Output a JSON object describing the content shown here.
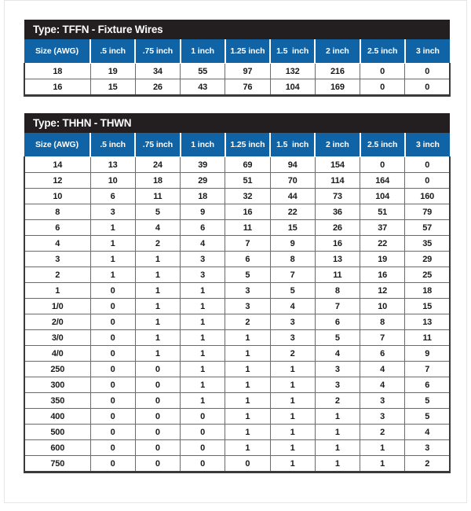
{
  "tables": [
    {
      "title": "Type: TFFN - Fixture Wires",
      "columns": [
        "Size (AWG)",
        ".5 inch",
        ".75 inch",
        "1 inch",
        "1.25 inch",
        "1.5  inch",
        "2 inch",
        "2.5 inch",
        "3 inch"
      ],
      "rows": [
        [
          "18",
          "19",
          "34",
          "55",
          "97",
          "132",
          "216",
          "0",
          "0"
        ],
        [
          "16",
          "15",
          "26",
          "43",
          "76",
          "104",
          "169",
          "0",
          "0"
        ]
      ]
    },
    {
      "title": "Type: THHN - THWN",
      "columns": [
        "Size (AWG)",
        ".5 inch",
        ".75 inch",
        "1 inch",
        "1.25 inch",
        "1.5  inch",
        "2 inch",
        "2.5 inch",
        "3 inch"
      ],
      "rows": [
        [
          "14",
          "13",
          "24",
          "39",
          "69",
          "94",
          "154",
          "0",
          "0"
        ],
        [
          "12",
          "10",
          "18",
          "29",
          "51",
          "70",
          "114",
          "164",
          "0"
        ],
        [
          "10",
          "6",
          "11",
          "18",
          "32",
          "44",
          "73",
          "104",
          "160"
        ],
        [
          "8",
          "3",
          "5",
          "9",
          "16",
          "22",
          "36",
          "51",
          "79"
        ],
        [
          "6",
          "1",
          "4",
          "6",
          "11",
          "15",
          "26",
          "37",
          "57"
        ],
        [
          "4",
          "1",
          "2",
          "4",
          "7",
          "9",
          "16",
          "22",
          "35"
        ],
        [
          "3",
          "1",
          "1",
          "3",
          "6",
          "8",
          "13",
          "19",
          "29"
        ],
        [
          "2",
          "1",
          "1",
          "3",
          "5",
          "7",
          "11",
          "16",
          "25"
        ],
        [
          "1",
          "0",
          "1",
          "1",
          "3",
          "5",
          "8",
          "12",
          "18"
        ],
        [
          "1/0",
          "0",
          "1",
          "1",
          "3",
          "4",
          "7",
          "10",
          "15"
        ],
        [
          "2/0",
          "0",
          "1",
          "1",
          "2",
          "3",
          "6",
          "8",
          "13"
        ],
        [
          "3/0",
          "0",
          "1",
          "1",
          "1",
          "3",
          "5",
          "7",
          "11"
        ],
        [
          "4/0",
          "0",
          "1",
          "1",
          "1",
          "2",
          "4",
          "6",
          "9"
        ],
        [
          "250",
          "0",
          "0",
          "1",
          "1",
          "1",
          "3",
          "4",
          "7"
        ],
        [
          "300",
          "0",
          "0",
          "1",
          "1",
          "1",
          "3",
          "4",
          "6"
        ],
        [
          "350",
          "0",
          "0",
          "1",
          "1",
          "1",
          "2",
          "3",
          "5"
        ],
        [
          "400",
          "0",
          "0",
          "0",
          "1",
          "1",
          "1",
          "3",
          "5"
        ],
        [
          "500",
          "0",
          "0",
          "0",
          "1",
          "1",
          "1",
          "2",
          "4"
        ],
        [
          "600",
          "0",
          "0",
          "0",
          "1",
          "1",
          "1",
          "1",
          "3"
        ],
        [
          "750",
          "0",
          "0",
          "0",
          "0",
          "1",
          "1",
          "1",
          "2"
        ]
      ]
    }
  ],
  "colors": {
    "header_blue": "#1064a6",
    "title_black": "#231f20",
    "grid_gray": "#6b6b6b",
    "text_dark": "#1a1a1a"
  }
}
